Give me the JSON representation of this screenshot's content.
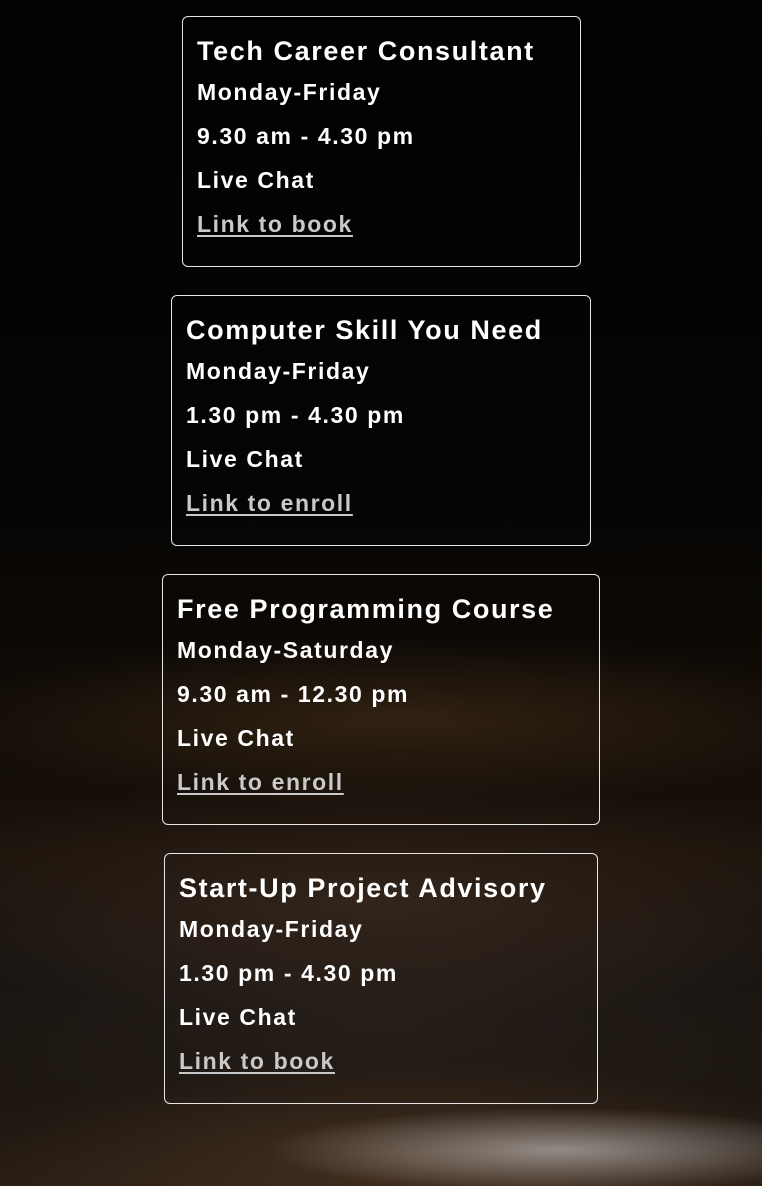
{
  "cards": [
    {
      "title": "Tech Career Consultant",
      "days": "Monday-Friday",
      "hours": "9.30 am - 4.30 pm",
      "channel": "Live Chat",
      "link": "Link to book"
    },
    {
      "title": "Computer Skill You Need",
      "days": "Monday-Friday",
      "hours": "1.30 pm - 4.30 pm",
      "channel": "Live Chat",
      "link": "Link to enroll"
    },
    {
      "title": "Free Programming Course",
      "days": "Monday-Saturday",
      "hours": "9.30 am - 12.30 pm",
      "channel": "Live Chat",
      "link": "Link to enroll"
    },
    {
      "title": "Start-Up Project Advisory",
      "days": "Monday-Friday",
      "hours": "1.30 pm - 4.30 pm",
      "channel": "Live Chat",
      "link": "Link to book"
    }
  ],
  "colors": {
    "text": "#ffffff",
    "link": "#c9c9c9",
    "card_border": "#e6e6e6",
    "background": "#000000"
  }
}
